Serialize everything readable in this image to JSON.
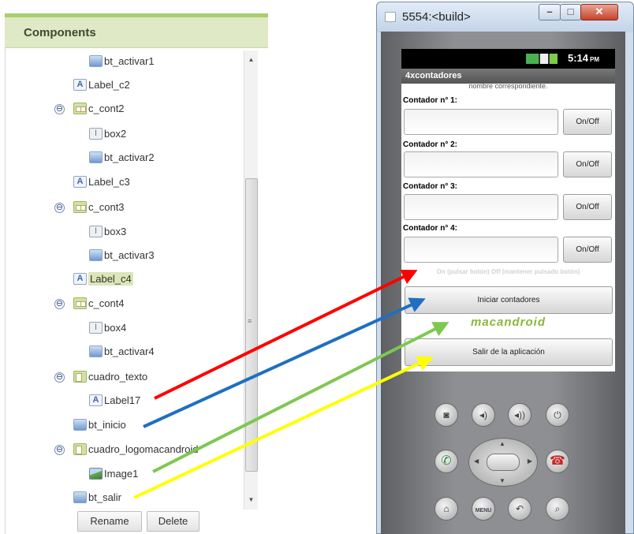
{
  "components": {
    "title": "Components",
    "tree": [
      {
        "label": "bt_activar1",
        "icon": "button-icon",
        "toggle": ""
      },
      {
        "label": "Label_c2",
        "icon": "label-icon",
        "toggle": ""
      },
      {
        "label": "c_cont2",
        "icon": "horizontal-arrangement-icon",
        "toggle": "⊖"
      },
      {
        "label": "box2",
        "icon": "textbox-icon",
        "toggle": ""
      },
      {
        "label": "bt_activar2",
        "icon": "button-icon",
        "toggle": ""
      },
      {
        "label": "Label_c3",
        "icon": "label-icon",
        "toggle": ""
      },
      {
        "label": "c_cont3",
        "icon": "horizontal-arrangement-icon",
        "toggle": "⊖"
      },
      {
        "label": "box3",
        "icon": "textbox-icon",
        "toggle": ""
      },
      {
        "label": "bt_activar3",
        "icon": "button-icon",
        "toggle": ""
      },
      {
        "label": "Label_c4",
        "icon": "label-icon",
        "toggle": "",
        "selected": true
      },
      {
        "label": "c_cont4",
        "icon": "horizontal-arrangement-icon",
        "toggle": "⊖"
      },
      {
        "label": "box4",
        "icon": "textbox-icon",
        "toggle": ""
      },
      {
        "label": "bt_activar4",
        "icon": "button-icon",
        "toggle": ""
      },
      {
        "label": "cuadro_texto",
        "icon": "vertical-arrangement-icon",
        "toggle": "⊖"
      },
      {
        "label": "Label17",
        "icon": "label-icon",
        "toggle": ""
      },
      {
        "label": "bt_inicio",
        "icon": "button-icon",
        "toggle": ""
      },
      {
        "label": "cuadro_logomacandroid",
        "icon": "vertical-arrangement-icon",
        "toggle": "⊖"
      },
      {
        "label": "Image1",
        "icon": "image-icon",
        "toggle": ""
      },
      {
        "label": "bt_salir",
        "icon": "button-icon",
        "toggle": ""
      }
    ],
    "rename_label": "Rename",
    "delete_label": "Delete"
  },
  "emulator": {
    "window_title": "5554:<build>",
    "clock": "5:14",
    "clock_suffix": "PM",
    "app_title": "4xcontadores",
    "truncated_text": "nombre correspondiente.",
    "counters": [
      "Contador n° 1:",
      "Contador n° 2:",
      "Contador n° 3:",
      "Contador n° 4:"
    ],
    "onoff_label": "On/Off",
    "hint": "On (pulsar botón) Off (mantener pulsado botón)",
    "start_label": "Iniciar contadores",
    "logo_text": "macandroid",
    "exit_label": "Salir de la aplicación"
  },
  "arrow_colors": {
    "label17": "#ff0000",
    "bt_inicio": "#1f6fc0",
    "image1": "#7ec850",
    "bt_salir": "#ffff00"
  }
}
